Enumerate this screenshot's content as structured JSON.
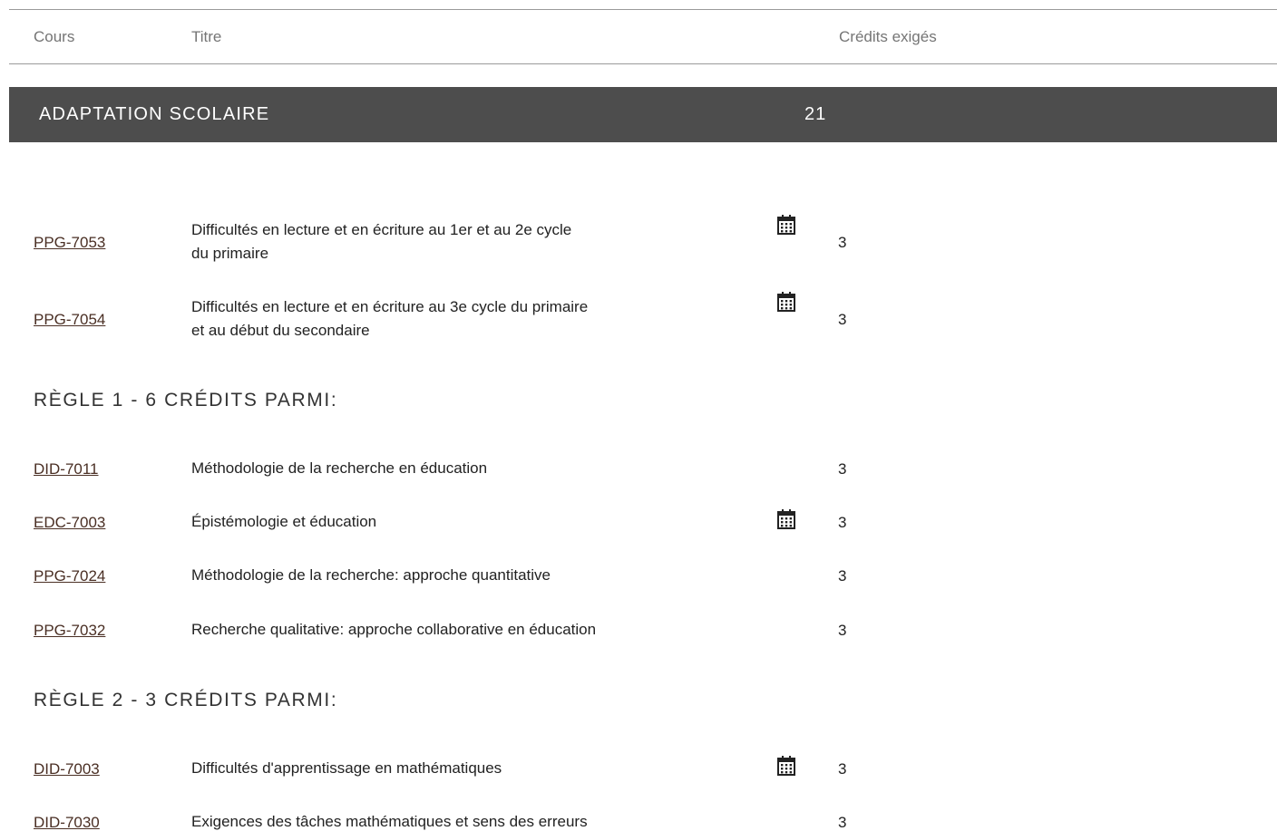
{
  "table_header": {
    "course": "Cours",
    "title": "Titre",
    "credits": "Crédits exigés"
  },
  "section": {
    "title": "ADAPTATION SCOLAIRE",
    "credits": "21"
  },
  "mandatory_courses": [
    {
      "code": "PPG-7053",
      "title_line1": "Difficultés en lecture et en écriture au 1er et au 2e cycle",
      "title_line2": "du primaire",
      "credits": "3",
      "calendar": true
    },
    {
      "code": "PPG-7054",
      "title_line1": "Difficultés en lecture et en écriture au 3e cycle du primaire",
      "title_line2": "et au début du secondaire",
      "credits": "3",
      "calendar": true
    }
  ],
  "rule1": {
    "heading": "RÈGLE 1 - 6 CRÉDITS PARMI:",
    "courses": [
      {
        "code": "DID-7011",
        "title": "Méthodologie de la recherche en éducation",
        "credits": "3",
        "calendar": false
      },
      {
        "code": "EDC-7003",
        "title": "Épistémologie et éducation",
        "credits": "3",
        "calendar": true
      },
      {
        "code": "PPG-7024",
        "title": "Méthodologie de la recherche: approche quantitative",
        "credits": "3",
        "calendar": false
      },
      {
        "code": "PPG-7032",
        "title": "Recherche qualitative: approche collaborative en éducation",
        "credits": "3",
        "calendar": false
      }
    ]
  },
  "rule2": {
    "heading": "RÈGLE 2 - 3 CRÉDITS PARMI:",
    "courses": [
      {
        "code": "DID-7003",
        "title": "Difficultés d'apprentissage en mathématiques",
        "credits": "3",
        "calendar": true
      },
      {
        "code": "DID-7030",
        "title": "Exigences des tâches mathématiques et sens des erreurs",
        "credits": "3",
        "calendar": false
      }
    ]
  },
  "icons": {
    "calendar": "calendar-icon"
  },
  "colors": {
    "section_bar": "#4d4d4d",
    "link": "#4a2f24",
    "header_text": "#757575"
  }
}
